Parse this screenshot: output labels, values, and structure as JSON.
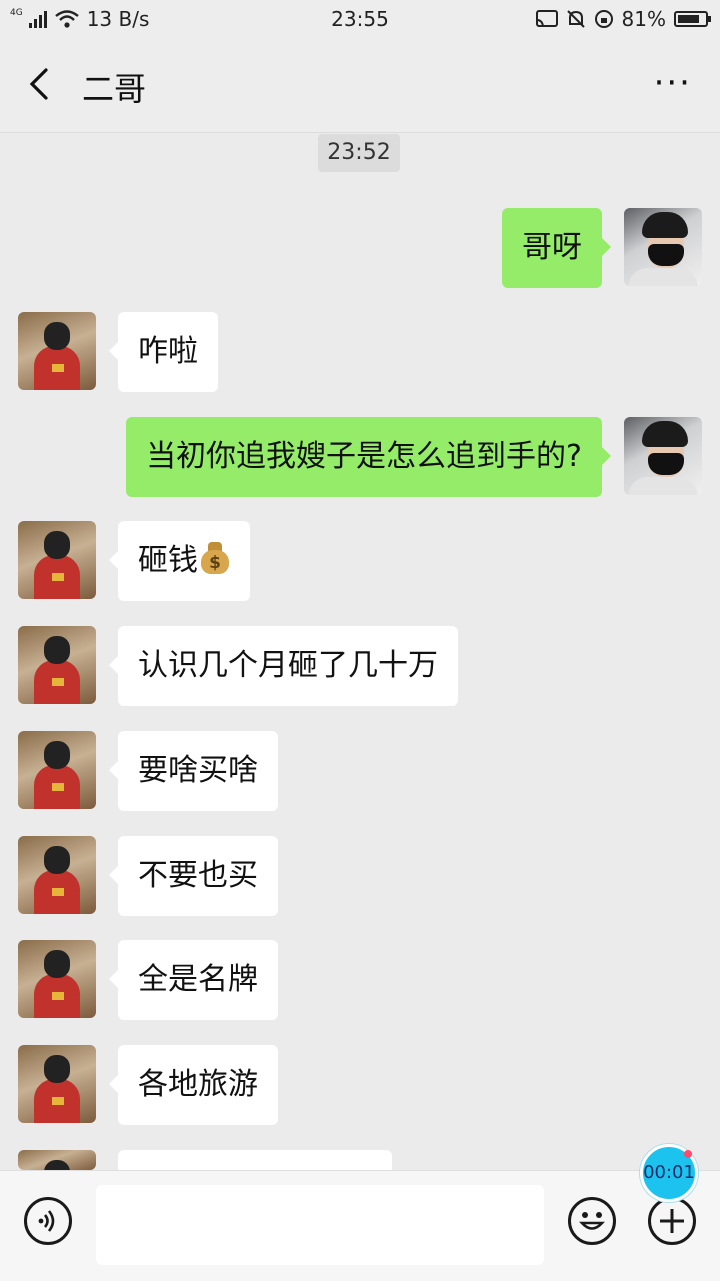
{
  "status_bar": {
    "network_type": "4G",
    "speed": "13 B/s",
    "time": "23:55",
    "battery": "81%",
    "battery_level": 0.81
  },
  "header": {
    "title": "二哥",
    "more_label": "···"
  },
  "chat": {
    "timestamp": "23:52",
    "messages": [
      {
        "from": "me",
        "text": "哥呀"
      },
      {
        "from": "friend",
        "text": "咋啦"
      },
      {
        "from": "me",
        "text": "当初你追我嫂子是怎么追到手的?"
      },
      {
        "from": "friend",
        "text": "砸钱",
        "emoji": "money-bag",
        "emoji_glyph": "$"
      },
      {
        "from": "friend",
        "text": "认识几个月砸了几十万"
      },
      {
        "from": "friend",
        "text": "要啥买啥"
      },
      {
        "from": "friend",
        "text": "不要也买"
      },
      {
        "from": "friend",
        "text": "全是名牌"
      },
      {
        "from": "friend",
        "text": "各地旅游"
      }
    ]
  },
  "recording": {
    "time": "00:01"
  },
  "input_bar": {
    "value": "",
    "placeholder": ""
  },
  "colors": {
    "my_bubble": "#95ec69",
    "friend_bubble": "#ffffff",
    "background": "#ebebeb",
    "recording_badge": "#1cc3ef"
  }
}
